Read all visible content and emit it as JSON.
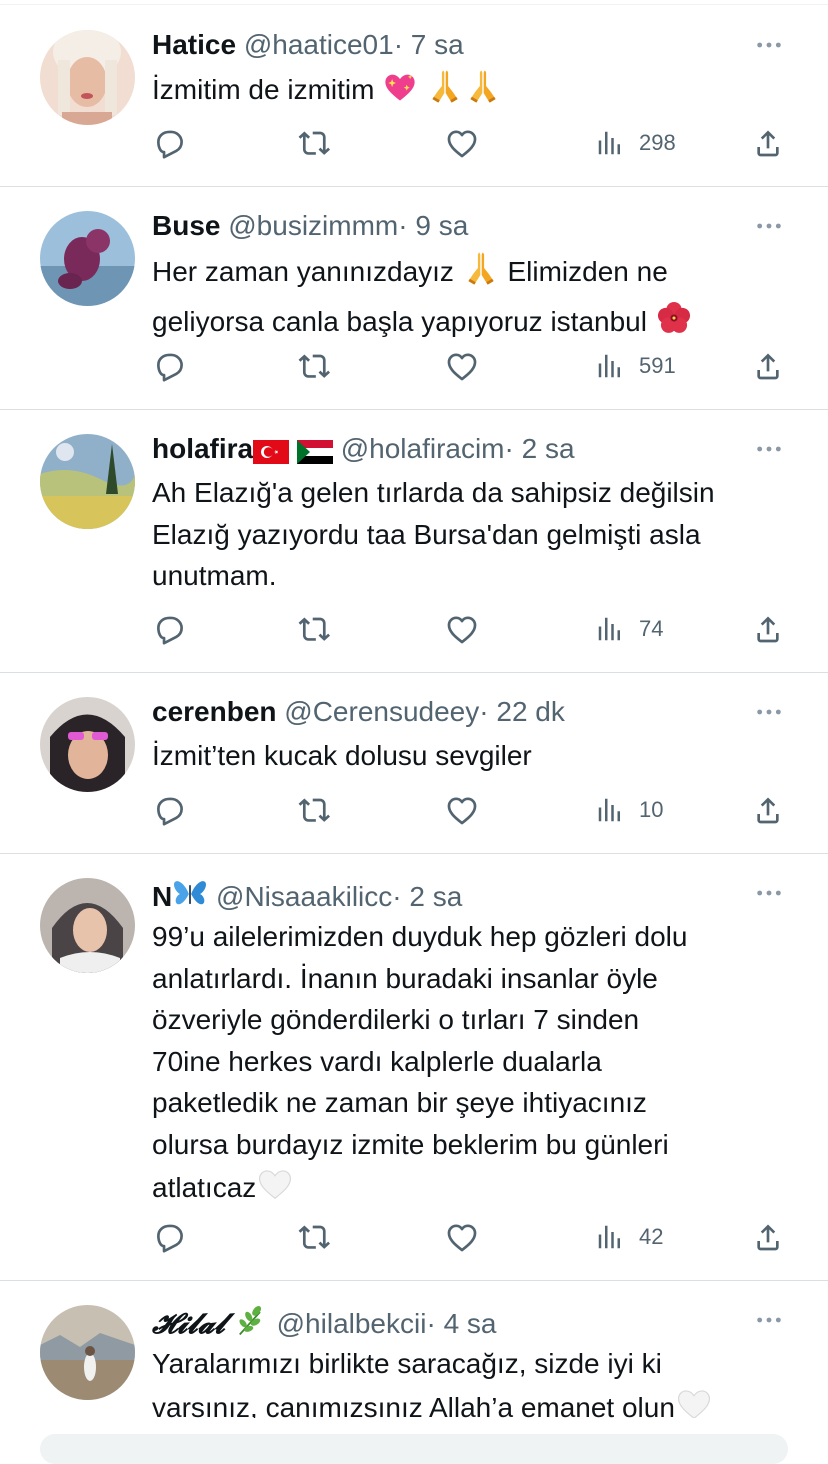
{
  "tweets": [
    {
      "name": "Hatice",
      "handle": "@haatice01",
      "dot": "·",
      "time": "7 sa",
      "text": "İzmitim de izmitim",
      "emojis": [
        "sparkling-heart",
        "folded-hands",
        "folded-hands"
      ],
      "views": "298",
      "avatar_color": "#e9c9b8"
    },
    {
      "name": "Buse",
      "handle": "@busizimmm",
      "dot": "·",
      "time": "9 sa",
      "text_line1": "Her zaman yanınızdayız",
      "text_line1b": "Elimizden ne",
      "text_line2": "geliyorsa canla başla yapıyoruz istanbul",
      "emojis": [
        "folded-hands",
        "hibiscus"
      ],
      "views": "591",
      "avatar_color": "#7aa3c4"
    },
    {
      "name": "holafira",
      "name_flags": [
        "turkey-flag",
        "sudan-flag"
      ],
      "handle": "@holafiracim",
      "dot": "·",
      "time": "2 sa",
      "text": "Ah Elazığ'a gelen tırlarda da sahipsiz değilsin\nElazığ yazıyordu taa Bursa'dan gelmişti asla\nunutmam.",
      "views": "74",
      "avatar_color": "#6b8f6a"
    },
    {
      "name": "cerenben",
      "handle": "@Cerensudeey",
      "dot": "·",
      "time": "22 dk",
      "text": "İzmit’ten kucak dolusu sevgiler",
      "views": "10",
      "avatar_color": "#3a2f3a"
    },
    {
      "name": "N",
      "name_emoji": "butterfly",
      "handle": "@Nisaaakilicc",
      "dot": "·",
      "time": "2 sa",
      "text": "99’u ailelerimizden duyduk hep gözleri dolu\nanlatırlardı. İnanın buradaki insanlar öyle\nözveriyle gönderdilerki o tırları 7 sinden\n70ine herkes vardı kalplerle dualarla\npaketledik ne zaman bir şeye ihtiyacınız\nolursa burdayız izmite beklerim bu günleri\natlatıcaz",
      "end_emoji": "white-heart",
      "views": "42",
      "avatar_color": "#5c5656"
    },
    {
      "name": "𝓗𝓲𝓵𝓪𝓵",
      "name_emoji": "herb",
      "handle": "@hilalbekcii",
      "dot": "·",
      "time": "4 sa",
      "text": "Yaralarımızı birlikte saracağız, sizde iyi ki\nvarsınız, canımızsınız Allah’a emanet olun",
      "end_emoji": "white-heart",
      "avatar_color": "#b8a48c"
    }
  ],
  "icons": {
    "reply": "reply-icon",
    "retweet": "retweet-icon",
    "like": "heart-icon",
    "views": "views-icon",
    "share": "share-icon",
    "more": "more-icon"
  },
  "colors": {
    "text": "#0f1419",
    "secondary": "#536471",
    "divider": "#dcdfe2"
  }
}
